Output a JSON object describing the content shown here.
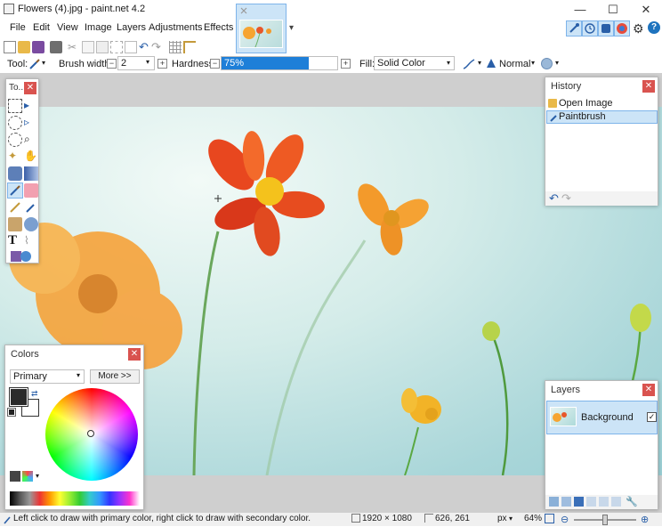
{
  "window": {
    "title": "Flowers (4).jpg - paint.net 4.2",
    "minimize_glyph": "—",
    "maximize_glyph": "☐",
    "close_glyph": "✕"
  },
  "menu": [
    "File",
    "Edit",
    "View",
    "Image",
    "Layers",
    "Adjustments",
    "Effects"
  ],
  "toolbar": {
    "tool_label": "Tool:",
    "brush_width_label": "Brush width:",
    "brush_width_value": "2",
    "hardness_label": "Hardness:",
    "hardness_value": "75%",
    "hardness_fraction": 0.75,
    "fill_label": "Fill:",
    "fill_value": "Solid Color",
    "blend_mode": "Normal",
    "minus_glyph": "−",
    "plus_glyph": "+",
    "chevron": "▾",
    "settings_glyph": "⚙",
    "help_glyph": "?"
  },
  "tools_panel": {
    "title": "To..."
  },
  "history_panel": {
    "title": "History",
    "items": [
      "Open Image",
      "Paintbrush"
    ],
    "selected_index": 1,
    "undo_glyph": "↶",
    "redo_glyph": "↷"
  },
  "colors_panel": {
    "title": "Colors",
    "mode": "Primary",
    "more_button": "More >>",
    "primary_color": "#2b2b2b",
    "secondary_color": "#ffffff"
  },
  "layers_panel": {
    "title": "Layers",
    "layers": [
      {
        "name": "Background",
        "visible": true
      }
    ]
  },
  "status": {
    "hint": "Left click to draw with primary color, right click to draw with secondary color.",
    "image_size": "1920 × 1080",
    "cursor_pos": "626, 261",
    "unit": "px",
    "zoom": "64%"
  },
  "colors": {
    "accent": "#cce4f7",
    "accent_border": "#7eb4ea",
    "close_red": "#d9534f",
    "selection": "#cce4f7"
  }
}
